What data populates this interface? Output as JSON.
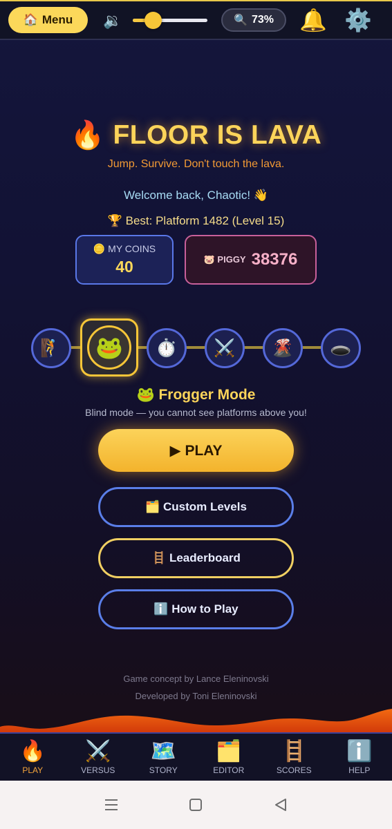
{
  "topbar": {
    "menu_icon": "🏠",
    "menu_label": "Menu",
    "volume_icon": "🔉",
    "volume_level": 0.27,
    "zoom_icon": "🔍",
    "zoom_label": "73%",
    "bell_icon": "🔔",
    "gear_icon": "⚙️"
  },
  "header": {
    "title_icon": "🔥",
    "title": "FLOOR IS LAVA",
    "subtitle": "Jump. Survive. Don't touch the lava.",
    "welcome": "Welcome back, Chaotic! 👋",
    "best": "🏆 Best: Platform 1482 (Level 15)"
  },
  "stats": {
    "coins_label": "🪙 MY COINS",
    "coins_value": "40",
    "piggy_label": "🐷 PIGGY",
    "piggy_value": "38376"
  },
  "modes": {
    "items": [
      {
        "icon": "🧗"
      },
      {
        "icon": "🐸"
      },
      {
        "icon": "⏱️"
      },
      {
        "icon": "⚔️"
      },
      {
        "icon": "🌋"
      },
      {
        "icon": "🕳️"
      }
    ],
    "selected_index": 1,
    "selected_name": "🐸 Frogger Mode",
    "selected_desc": "Blind mode — you cannot see platforms above you!"
  },
  "actions": {
    "play_label": "▶ PLAY",
    "custom_levels_label": "🗂️ Custom Levels",
    "leaderboard_label": "🪜 Leaderboard",
    "how_to_play_label": "ℹ️ How to Play"
  },
  "credits": {
    "concept": "Game concept by Lance Eleninovski",
    "developed": "Developed by Toni Eleninovski"
  },
  "nav": {
    "items": [
      {
        "icon": "🔥",
        "label": "PLAY"
      },
      {
        "icon": "⚔️",
        "label": "VERSUS"
      },
      {
        "icon": "🗺️",
        "label": "STORY"
      },
      {
        "icon": "🗂️",
        "label": "EDITOR"
      },
      {
        "icon": "🪜",
        "label": "SCORES"
      },
      {
        "icon": "ℹ️",
        "label": "HELP"
      }
    ],
    "active_index": 0
  },
  "colors": {
    "accent_gold": "#fcd45a",
    "accent_orange": "#f29a34",
    "accent_blue": "#5a7ee8",
    "lava": "#f06a10"
  }
}
